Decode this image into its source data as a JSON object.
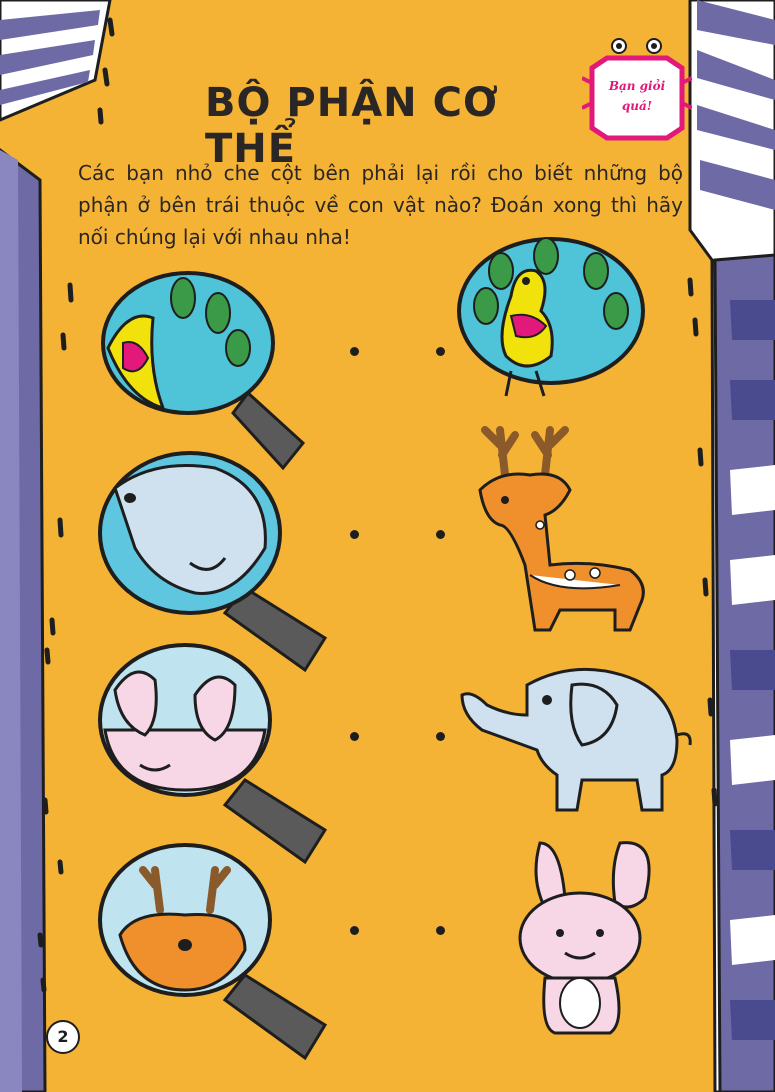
{
  "page": {
    "title": "BỘ PHẬN CƠ THỂ",
    "badge": {
      "line1": "Bạn giỏi",
      "line2": "quá!"
    },
    "instructions": "Các bạn nhỏ che cột bên phải lại rồi cho biết những bộ phận ở bên trái thuộc về con vật nào? Đoán xong thì hãy nối chúng lại với nhau nha!",
    "page_number": "2"
  },
  "left_column": [
    {
      "name": "peacock-tail-closeup",
      "icon": "magnifier-peacock-icon"
    },
    {
      "name": "elephant-trunk-closeup",
      "icon": "magnifier-elephant-icon"
    },
    {
      "name": "rabbit-ears-closeup",
      "icon": "magnifier-rabbit-icon"
    },
    {
      "name": "deer-antlers-closeup",
      "icon": "magnifier-deer-icon"
    }
  ],
  "right_column": [
    {
      "name": "peacock",
      "icon": "peacock-icon"
    },
    {
      "name": "deer",
      "icon": "deer-icon"
    },
    {
      "name": "elephant",
      "icon": "elephant-icon"
    },
    {
      "name": "rabbit",
      "icon": "rabbit-icon"
    }
  ],
  "colors": {
    "background": "#f5b335",
    "building_purple": "#6e6aa6",
    "glass": "#bfe3ef",
    "badge_pink": "#e2187a",
    "ink": "#1e1e1e"
  }
}
